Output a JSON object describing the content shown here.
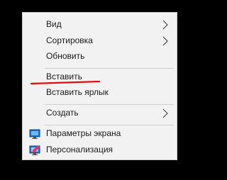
{
  "context_menu": {
    "items": [
      {
        "label": "Вид",
        "submenu": true
      },
      {
        "label": "Сортировка",
        "submenu": true
      },
      {
        "label": "Обновить",
        "submenu": false
      },
      {
        "label": "Вставить",
        "submenu": false
      },
      {
        "label": "Вставить ярлык",
        "submenu": false
      },
      {
        "label": "Создать",
        "submenu": true
      },
      {
        "label": "Параметры экрана",
        "icon": "display-settings-icon"
      },
      {
        "label": "Персонализация",
        "icon": "personalization-icon"
      }
    ],
    "annotation_color": "#e01010"
  }
}
